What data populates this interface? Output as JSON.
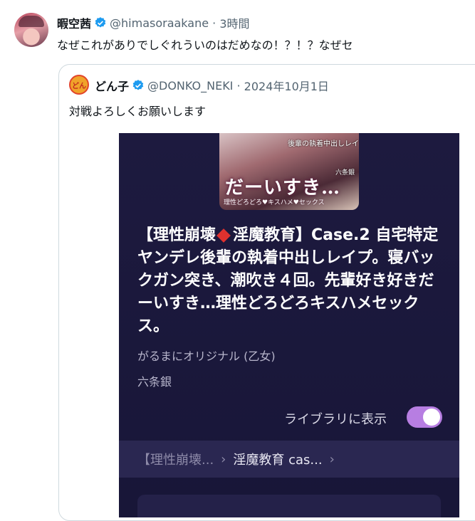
{
  "tweet": {
    "display_name": "暇空茜",
    "handle": "@himasoraakane",
    "time": "3時間",
    "text": "なぜこれがありでしぐれういのはだめなの！？！？なぜセ"
  },
  "quoted": {
    "avatar_text": "どん",
    "display_name": "どん子",
    "handle": "@DONKO_NEKI",
    "date": "2024年10月1日",
    "text": "対戦よろしくお願いします",
    "card": {
      "cover_title": "だーいすき…",
      "cover_sub": "後輩の執着中出しレイプ",
      "cover_caption": "理性どろどろ♥キスハメ♥セックス",
      "cover_author": "六条銀",
      "title_before": "【理性崩壊",
      "title_after": "淫魔教育】Case.2 自宅特定ヤンデレ後輩の執着中出しレイプ。寝バックガン突き、潮吹き４回。先輩好き好きだーいすき…理性どろどろキスハメセックス。",
      "label": "がるまにオリジナル (乙女)",
      "author": "六条銀",
      "library_label": "ライブラリに表示",
      "library_on": true,
      "breadcrumb_1": "【理性崩壊...",
      "breadcrumb_2": "淫魔教育 cas...",
      "toggle_color": "#b77ee2"
    }
  }
}
